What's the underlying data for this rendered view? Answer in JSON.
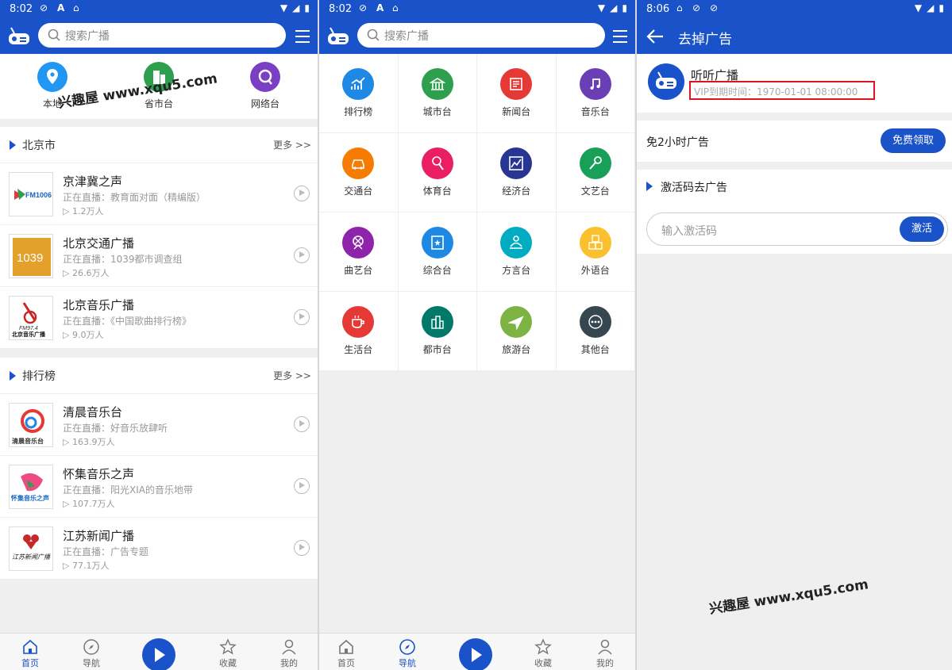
{
  "search_placeholder": "搜索广播",
  "screen1": {
    "status_time": "8:02",
    "quick": [
      {
        "label": "本地"
      },
      {
        "label": "省市台"
      },
      {
        "label": "网络台"
      }
    ],
    "section_beijing": {
      "title": "北京市",
      "more": "更多 >>",
      "items": [
        {
          "name": "京津冀之声",
          "live": "正在直播：教育面对面（精编版）",
          "count": "▷ 1.2万人"
        },
        {
          "name": "北京交通广播",
          "live": "正在直播：1039都市调查组",
          "count": "▷ 26.6万人"
        },
        {
          "name": "北京音乐广播",
          "live": "正在直播：《中国歌曲排行榜》",
          "count": "▷ 9.0万人"
        }
      ]
    },
    "section_rank": {
      "title": "排行榜",
      "more": "更多 >>",
      "items": [
        {
          "name": "清晨音乐台",
          "live": "正在直播：好音乐放肆听",
          "count": "▷ 163.9万人"
        },
        {
          "name": "怀集音乐之声",
          "live": "正在直播：阳光XIA的音乐地带",
          "count": "▷ 107.7万人"
        },
        {
          "name": "江苏新闻广播",
          "live": "正在直播：广告专题",
          "count": "▷ 77.1万人"
        }
      ]
    },
    "thumb_text": {
      "fm1006": "FM1006",
      "t1039": "1039",
      "fm974": "FM97.4",
      "t974": "北京音乐广播",
      "qc": "清晨音乐台",
      "hj": "怀集音乐之声",
      "js": "江苏新闻广播"
    }
  },
  "screen2": {
    "status_time": "8:02",
    "categories": [
      {
        "label": "排行榜",
        "color": "#1e88e5",
        "icon": "chart-icon"
      },
      {
        "label": "城市台",
        "color": "#2e9e4f",
        "icon": "building-icon"
      },
      {
        "label": "新闻台",
        "color": "#e53935",
        "icon": "news-icon"
      },
      {
        "label": "音乐台",
        "color": "#6a3fb5",
        "icon": "music-icon"
      },
      {
        "label": "交通台",
        "color": "#f57c00",
        "icon": "car-icon"
      },
      {
        "label": "体育台",
        "color": "#e91e63",
        "icon": "sport-icon"
      },
      {
        "label": "经济台",
        "color": "#283593",
        "icon": "economy-icon"
      },
      {
        "label": "文艺台",
        "color": "#18a058",
        "icon": "microphone-icon"
      },
      {
        "label": "曲艺台",
        "color": "#8e24aa",
        "icon": "opera-icon"
      },
      {
        "label": "综合台",
        "color": "#1e88e5",
        "icon": "book-icon"
      },
      {
        "label": "方言台",
        "color": "#00acc1",
        "icon": "person-icon"
      },
      {
        "label": "外语台",
        "color": "#fbc02d",
        "icon": "abc-icon"
      },
      {
        "label": "生活台",
        "color": "#e53935",
        "icon": "cup-icon"
      },
      {
        "label": "都市台",
        "color": "#00796b",
        "icon": "city-icon"
      },
      {
        "label": "旅游台",
        "color": "#7cb342",
        "icon": "plane-icon"
      },
      {
        "label": "其他台",
        "color": "#37474f",
        "icon": "more-icon"
      }
    ]
  },
  "screen3": {
    "status_time": "8:06",
    "title": "去掉广告",
    "profile_name": "听听广播",
    "vip_text": "VIP到期时间：1970-01-01 08:00:00",
    "free_label": "免2小时广告",
    "free_button": "免费领取",
    "code_section": "激活码去广告",
    "code_placeholder": "输入激活码",
    "activate_button": "激活"
  },
  "tabs": {
    "home": "首页",
    "nav": "导航",
    "fav": "收藏",
    "mine": "我的"
  },
  "watermark": "兴趣屋 www.xqu5.com",
  "colors": {
    "primary": "#1a53c9",
    "highlight_box": "#e0141e"
  }
}
